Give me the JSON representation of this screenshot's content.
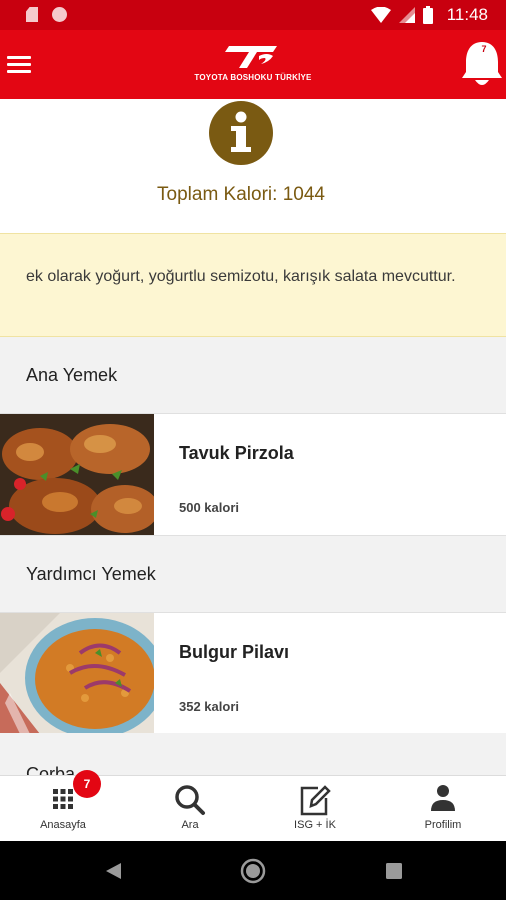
{
  "status_bar": {
    "time": "11:48"
  },
  "app_bar": {
    "logo_text": "TOYOTA BOSHOKU TÜRKİYE",
    "notification_count": "7"
  },
  "summary": {
    "total_calories": "Toplam Kalori: 1044"
  },
  "notice": {
    "text": "ek olarak yoğurt, yoğurtlu semizotu, karışık salata mevcuttur."
  },
  "sections": [
    {
      "title": "Ana Yemek",
      "dish": "Tavuk Pirzola",
      "calories": "500 kalori"
    },
    {
      "title": "Yardımcı Yemek",
      "dish": "Bulgur Pilavı",
      "calories": "352 kalori"
    },
    {
      "title": "Çorba"
    }
  ],
  "bottom_nav": [
    {
      "label": "Anasayfa",
      "badge": "7"
    },
    {
      "label": "Ara"
    },
    {
      "label": "ISG + İK"
    },
    {
      "label": "Profilim"
    }
  ],
  "colors": {
    "brand_red": "#e30613",
    "accent_gold": "#7a5a12",
    "notice_bg": "#fdf6d2"
  }
}
